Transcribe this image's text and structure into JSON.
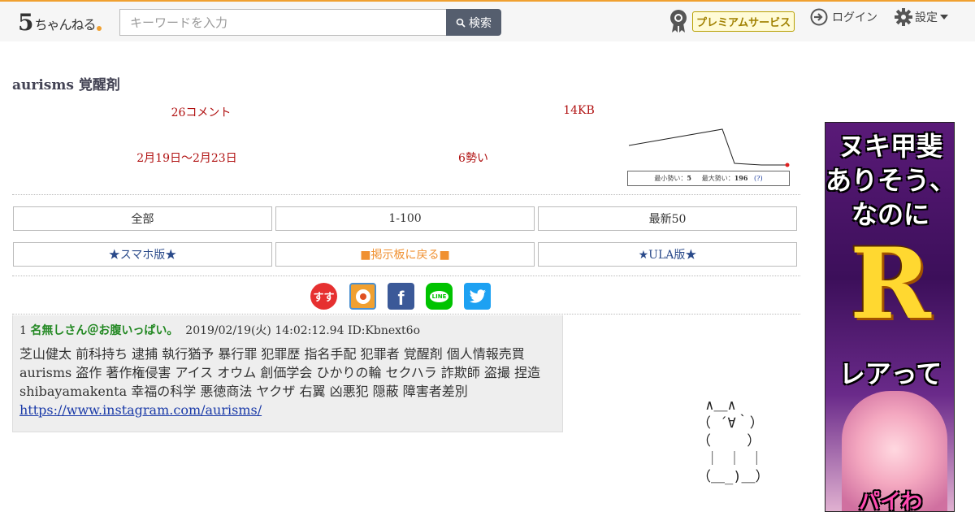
{
  "header": {
    "logo_num": "5",
    "logo_text": "ちゃんねる",
    "search_placeholder": "キーワードを入力",
    "search_label": "検索",
    "premium_label": "プレミアムサービス",
    "login_label": "ログイン",
    "settings_label": "設定"
  },
  "thread": {
    "title": "aurisms 覚醒剤",
    "comments": "26コメント",
    "size": "14KB",
    "dates": "2月19日〜2月23日",
    "momentum": "6勢い",
    "graph_legend_min_label": "最小勢い：",
    "graph_legend_min": "5",
    "graph_legend_max_label": "最大勢い：",
    "graph_legend_max": "196",
    "graph_legend_help": "(?)"
  },
  "nav": {
    "all": "全部",
    "range": "1-100",
    "latest": "最新50",
    "smartphone": "★スマホ版★",
    "back": "■掲示板に戻る■",
    "ula": "★ULA版★"
  },
  "share": [
    "sumaho-share-icon",
    "bookmark-icon",
    "facebook-icon",
    "line-icon",
    "twitter-icon"
  ],
  "share_labels": {
    "sumaho": "すす",
    "facebook": "f",
    "line": "LINE"
  },
  "post": {
    "number": "1",
    "name": "名無しさん＠お腹いっぱい。",
    "datetime": "2019/02/19(火) 14:02:12.94",
    "id": "ID:Kbnext6o",
    "body_line1": "芝山健太 前科持ち 逮捕 執行猶予 暴行罪 犯罪歴 指名手配 犯罪者 覚醒剤 個人情報売買",
    "body_line2": "aurisms 盗作 著作権侵害 アイス オウム 創価学会 ひかりの輪 セクハラ 詐欺師 盗撮 捏造",
    "body_line3": "shibayamakenta 幸福の科学 悪徳商法 ヤクザ 右翼 凶悪犯 隠蔽 障害者差別",
    "link": "https://www.instagram.com/aurisms/"
  },
  "ascii_art": " ∧＿∧\n（ ´∀｀）\n（　　 ）\n ｜ ｜ ｜\n（＿_)＿）",
  "ad": {
    "line1": "ヌキ甲斐",
    "line2": "ありそう、",
    "line3": "なのに",
    "big": "R",
    "line4": "レアって",
    "line5": "パイわ"
  },
  "colors": {
    "accent": "#f0a030",
    "red_meta": "#b01010",
    "post_name": "#228822",
    "link": "#1a3aa8"
  }
}
